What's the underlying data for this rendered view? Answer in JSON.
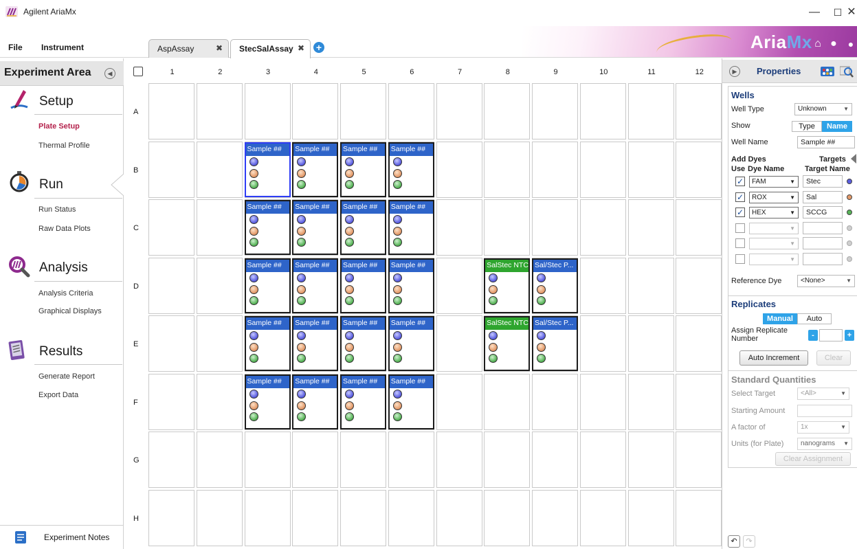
{
  "window": {
    "title": "Agilent AriaMx",
    "controls": {
      "minimize": "—",
      "maximize": "☐",
      "close": "✕"
    }
  },
  "menu": {
    "file": "File",
    "instrument": "Instrument"
  },
  "tabs": [
    {
      "label": "AspAssay",
      "close": "✖",
      "active": false
    },
    {
      "label": "StecSalAssay",
      "close": "✖",
      "active": true
    }
  ],
  "tab_add": "+",
  "brand": {
    "aria": "Aria",
    "mx": "Mx"
  },
  "left_panel": {
    "title": "Experiment Area",
    "collapse": "◀",
    "sections": [
      {
        "title": "Setup",
        "icon": "setup-pen-icon",
        "links": [
          "Plate Setup",
          "Thermal Profile"
        ],
        "active_link": "Plate Setup"
      },
      {
        "title": "Run",
        "icon": "run-stopwatch-icon",
        "links": [
          "Run Status",
          "Raw Data Plots"
        ]
      },
      {
        "title": "Analysis",
        "icon": "analysis-magnifier-icon",
        "links": [
          "Analysis Criteria",
          "Graphical Displays"
        ]
      },
      {
        "title": "Results",
        "icon": "results-report-icon",
        "links": [
          "Generate Report",
          "Export Data"
        ]
      }
    ],
    "notes": "Experiment Notes"
  },
  "plate": {
    "columns": [
      "1",
      "2",
      "3",
      "4",
      "5",
      "6",
      "7",
      "8",
      "9",
      "10",
      "11",
      "12"
    ],
    "rows": [
      "A",
      "B",
      "C",
      "D",
      "E",
      "F",
      "G",
      "H"
    ],
    "wells": [
      {
        "row": "B",
        "col": 3,
        "name": "Sample ##",
        "kind": "sample",
        "selected": true
      },
      {
        "row": "B",
        "col": 4,
        "name": "Sample ##",
        "kind": "sample"
      },
      {
        "row": "B",
        "col": 5,
        "name": "Sample ##",
        "kind": "sample"
      },
      {
        "row": "B",
        "col": 6,
        "name": "Sample ##",
        "kind": "sample"
      },
      {
        "row": "C",
        "col": 3,
        "name": "Sample ##",
        "kind": "sample"
      },
      {
        "row": "C",
        "col": 4,
        "name": "Sample ##",
        "kind": "sample"
      },
      {
        "row": "C",
        "col": 5,
        "name": "Sample ##",
        "kind": "sample"
      },
      {
        "row": "C",
        "col": 6,
        "name": "Sample ##",
        "kind": "sample"
      },
      {
        "row": "D",
        "col": 3,
        "name": "Sample ##",
        "kind": "sample"
      },
      {
        "row": "D",
        "col": 4,
        "name": "Sample ##",
        "kind": "sample"
      },
      {
        "row": "D",
        "col": 5,
        "name": "Sample ##",
        "kind": "sample"
      },
      {
        "row": "D",
        "col": 6,
        "name": "Sample ##",
        "kind": "sample"
      },
      {
        "row": "D",
        "col": 8,
        "name": "SalStec NTC",
        "kind": "ntc"
      },
      {
        "row": "D",
        "col": 9,
        "name": "Sal/Stec P...",
        "kind": "std"
      },
      {
        "row": "E",
        "col": 3,
        "name": "Sample ##",
        "kind": "sample"
      },
      {
        "row": "E",
        "col": 4,
        "name": "Sample ##",
        "kind": "sample"
      },
      {
        "row": "E",
        "col": 5,
        "name": "Sample ##",
        "kind": "sample"
      },
      {
        "row": "E",
        "col": 6,
        "name": "Sample ##",
        "kind": "sample"
      },
      {
        "row": "E",
        "col": 8,
        "name": "SalStec NTC",
        "kind": "ntc"
      },
      {
        "row": "E",
        "col": 9,
        "name": "Sal/Stec P...",
        "kind": "std"
      },
      {
        "row": "F",
        "col": 3,
        "name": "Sample ##",
        "kind": "sample"
      },
      {
        "row": "F",
        "col": 4,
        "name": "Sample ##",
        "kind": "sample"
      },
      {
        "row": "F",
        "col": 5,
        "name": "Sample ##",
        "kind": "sample"
      },
      {
        "row": "F",
        "col": 6,
        "name": "Sample ##",
        "kind": "sample"
      }
    ]
  },
  "properties": {
    "title": "Properties",
    "expand": "▶",
    "wells": {
      "title": "Wells",
      "well_type_label": "Well Type",
      "well_type_value": "Unknown",
      "show_label": "Show",
      "show_type": "Type",
      "show_name": "Name",
      "well_name_label": "Well Name",
      "well_name_value": "Sample ##",
      "add_dyes": "Add Dyes",
      "targets": "Targets",
      "use_header": "Use",
      "dye_name_header": "Dye Name",
      "target_name_header": "Target Name",
      "dyes": [
        {
          "checked": true,
          "dye": "FAM",
          "target": "Stec",
          "color": "#5b5ee0"
        },
        {
          "checked": true,
          "dye": "ROX",
          "target": "Sal",
          "color": "#e39a6a"
        },
        {
          "checked": true,
          "dye": "HEX",
          "target": "SCCG",
          "color": "#58b458"
        },
        {
          "checked": false,
          "dye": "",
          "target": "",
          "color": "#cfcfcf"
        },
        {
          "checked": false,
          "dye": "",
          "target": "",
          "color": "#cfcfcf"
        },
        {
          "checked": false,
          "dye": "",
          "target": "",
          "color": "#cfcfcf"
        }
      ],
      "reference_dye_label": "Reference Dye",
      "reference_dye_value": "<None>"
    },
    "replicates": {
      "title": "Replicates",
      "manual": "Manual",
      "auto": "Auto",
      "assign_label": "Assign Replicate Number",
      "decrement": "-",
      "increment": "+",
      "auto_increment": "Auto Increment",
      "clear": "Clear"
    },
    "standard_quantities": {
      "title": "Standard Quantities",
      "select_target_label": "Select Target",
      "select_target_value": "<All>",
      "starting_amount_label": "Starting Amount",
      "factor_label": "A factor of",
      "factor_value": "1x",
      "units_label": "Units (for Plate)",
      "units_value": "nanograms",
      "clear_assignment": "Clear Assignment"
    },
    "undo": "↶",
    "redo": "↷"
  },
  "colors": {
    "accent": "#2fa3e8",
    "well_name_sample": "#2e64c9",
    "well_name_ntc": "#2ea52e",
    "nav_active": "#b4224c"
  }
}
